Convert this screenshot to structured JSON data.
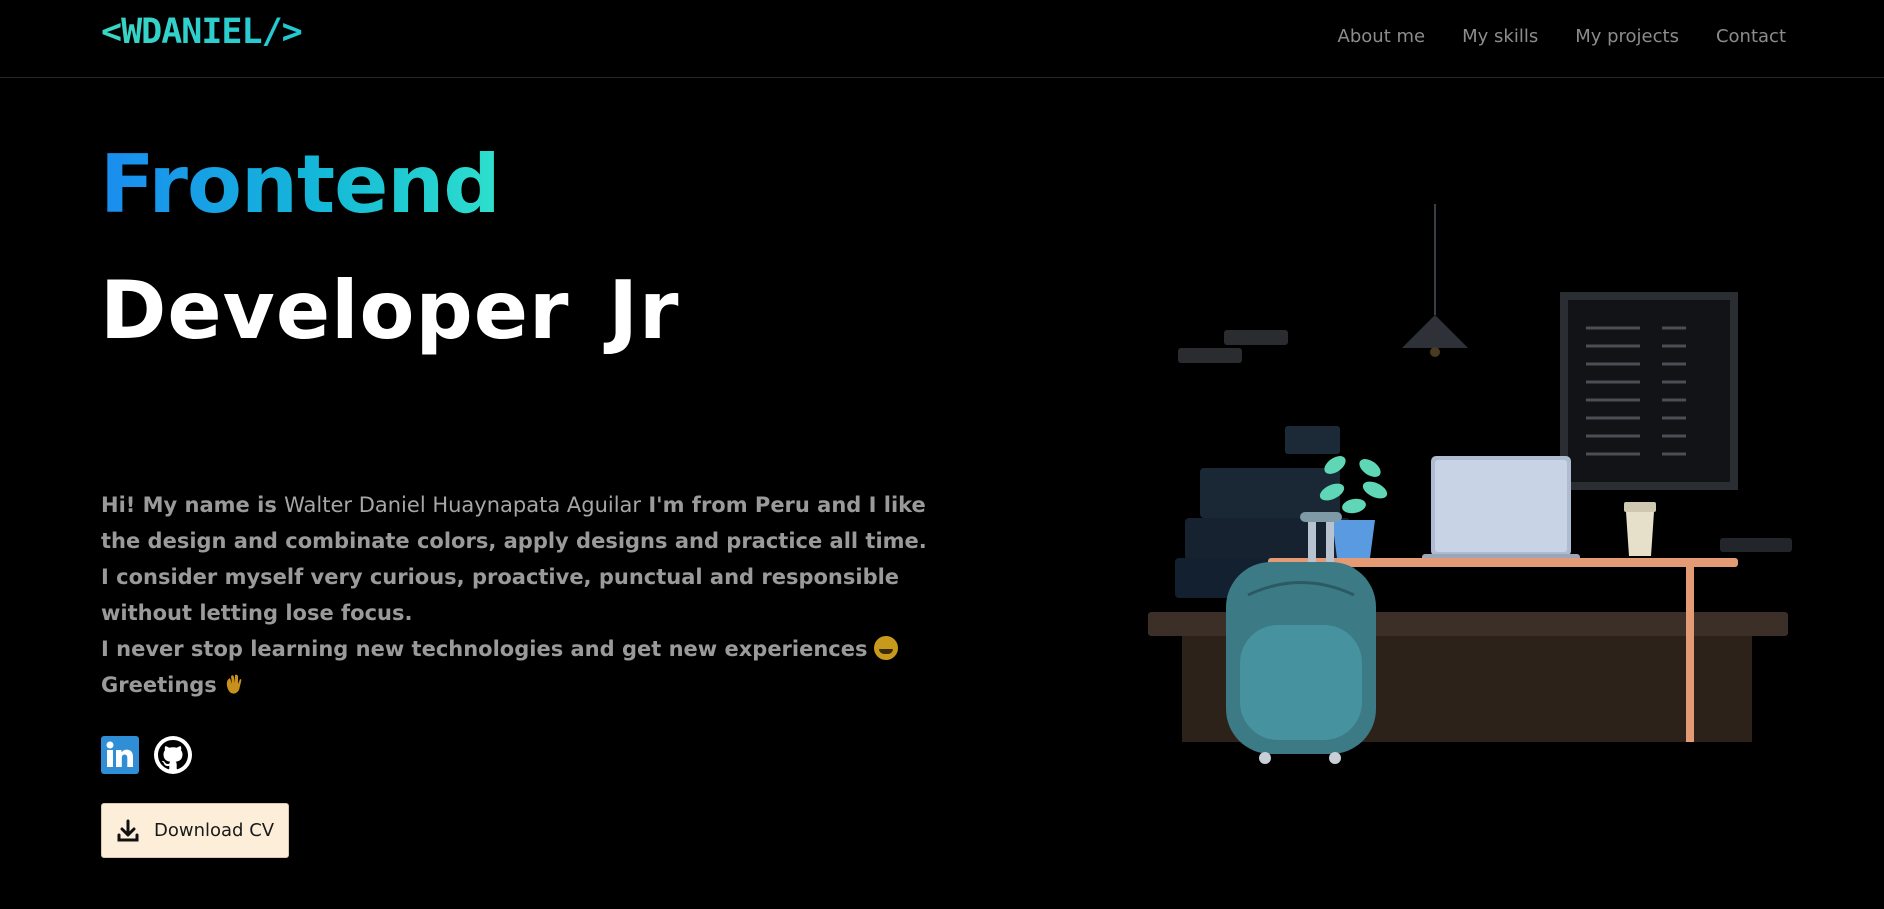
{
  "header": {
    "logo": "<WDANIEL/>",
    "nav": [
      "About me",
      "My skills",
      "My projects",
      "Contact"
    ]
  },
  "hero": {
    "title_line1": "Frontend",
    "title_line2": "Developer  Jr",
    "intro": {
      "line1_prefix": "Hi! My name is ",
      "name": "Walter Daniel Huaynapata Aguilar",
      "line1_suffix": " I'm from Peru and I like the design and combinate colors, apply designs and practice all time.",
      "line2": "I consider myself very curious, proactive, punctual and responsible without letting lose focus.",
      "line3": "I never stop learning new technologies and get new experiences",
      "line4": "Greetings"
    },
    "social_icons": [
      "linkedin-icon",
      "github-icon"
    ],
    "download_button": "Download CV"
  },
  "colors": {
    "background": "#000000",
    "accent_teal": "#2dd4bf",
    "accent_blue": "#1a8cf0",
    "nav_text": "#8c8c8c",
    "button_bg": "#fdeed9"
  }
}
